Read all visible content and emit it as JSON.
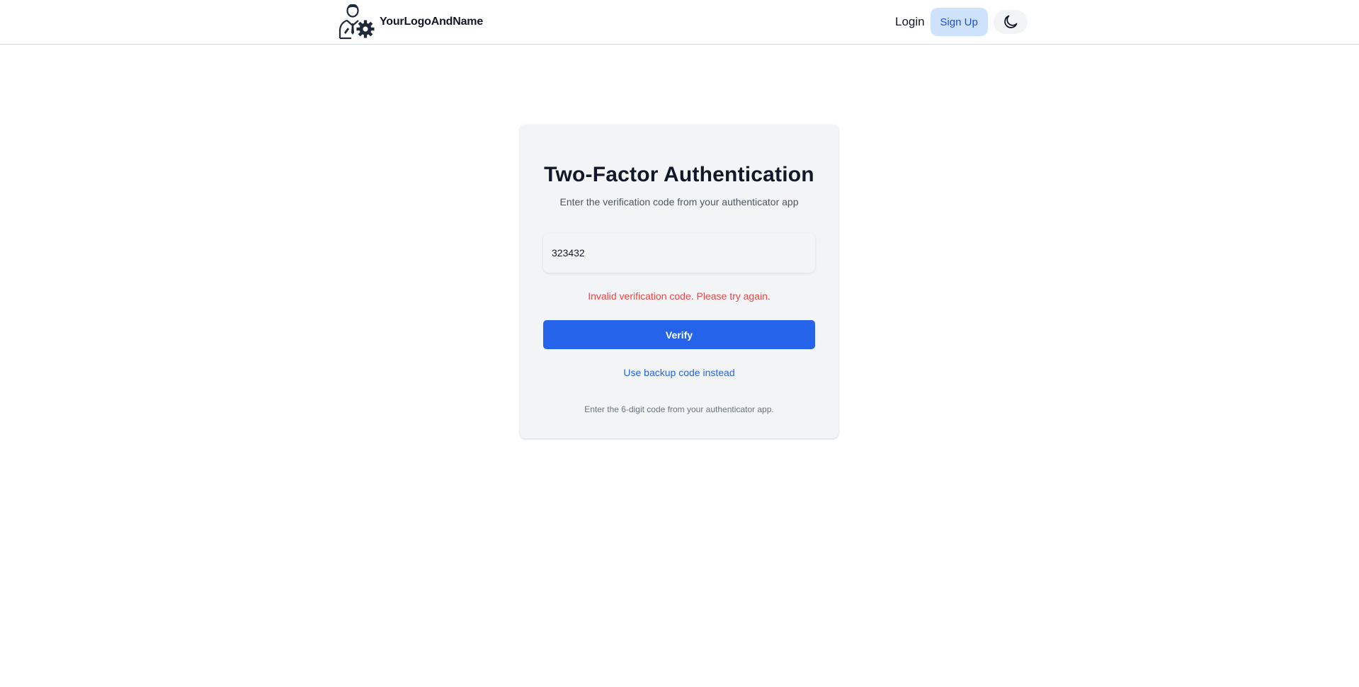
{
  "nav": {
    "brand_name": "YourLogoAndName",
    "login_label": "Login",
    "signup_label": "Sign Up",
    "theme_icon": "moon-icon",
    "logo_icon": "person-gear-logo-icon"
  },
  "auth": {
    "title": "Two-Factor Authentication",
    "subtitle": "Enter the verification code from your authenticator app",
    "code_value": "323432",
    "error_message": "Invalid verification code. Please try again.",
    "verify_label": "Verify",
    "backup_link": "Use backup code instead",
    "hint": "Enter the 6-digit code from your authenticator app."
  },
  "colors": {
    "primary": "#2563eb",
    "error": "#ef4444",
    "card_bg": "#f3f4f6",
    "signup_bg": "#cfe2fb"
  }
}
